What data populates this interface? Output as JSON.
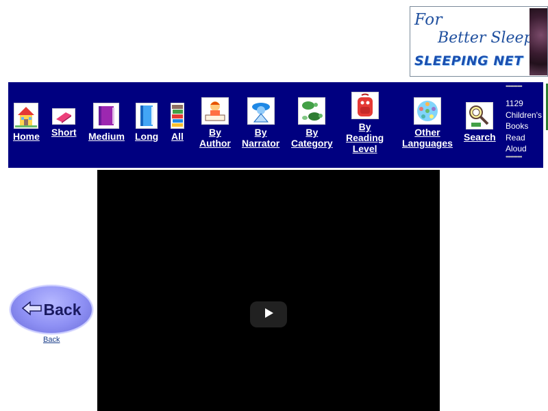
{
  "banner": {
    "line1": "For",
    "line2": "Better Sleep",
    "line3": "SLEEPING NET"
  },
  "nav": {
    "items": [
      {
        "id": "home",
        "label_lines": [
          "Home"
        ],
        "icon": "house-icon"
      },
      {
        "id": "short",
        "label_lines": [
          "Short"
        ],
        "icon": "small-book-icon"
      },
      {
        "id": "medium",
        "label_lines": [
          "Medium"
        ],
        "icon": "purple-book-icon"
      },
      {
        "id": "long",
        "label_lines": [
          "Long"
        ],
        "icon": "blue-book-icon"
      },
      {
        "id": "all",
        "label_lines": [
          "All"
        ],
        "icon": "book-stack-icon"
      },
      {
        "id": "by-author",
        "label_lines": [
          "By",
          "Author"
        ],
        "icon": "writer-icon"
      },
      {
        "id": "by-narrator",
        "label_lines": [
          "By",
          "Narrator"
        ],
        "icon": "narrator-icon"
      },
      {
        "id": "by-category",
        "label_lines": [
          "By",
          "Category"
        ],
        "icon": "turtles-icon"
      },
      {
        "id": "by-reading-level",
        "label_lines": [
          "By",
          "Reading",
          "Level"
        ],
        "icon": "backpack-icon"
      },
      {
        "id": "other-languages",
        "label_lines": [
          "Other",
          "Languages"
        ],
        "icon": "globe-icon"
      },
      {
        "id": "search",
        "label_lines": [
          "Search"
        ],
        "icon": "magnifier-kid-icon"
      }
    ],
    "counter": {
      "dots_top": "•••••••••••",
      "text_lines": [
        "1129",
        "Children's",
        "Books",
        "Read",
        "Aloud"
      ],
      "dots_bottom": "•••••••••••"
    }
  },
  "back": {
    "button_label": "Back",
    "link_label": "Back"
  },
  "video": {
    "play_icon": "play-icon"
  },
  "colors": {
    "nav_background": "#000080",
    "video_background": "#000000",
    "back_button": "#8e90f4"
  }
}
